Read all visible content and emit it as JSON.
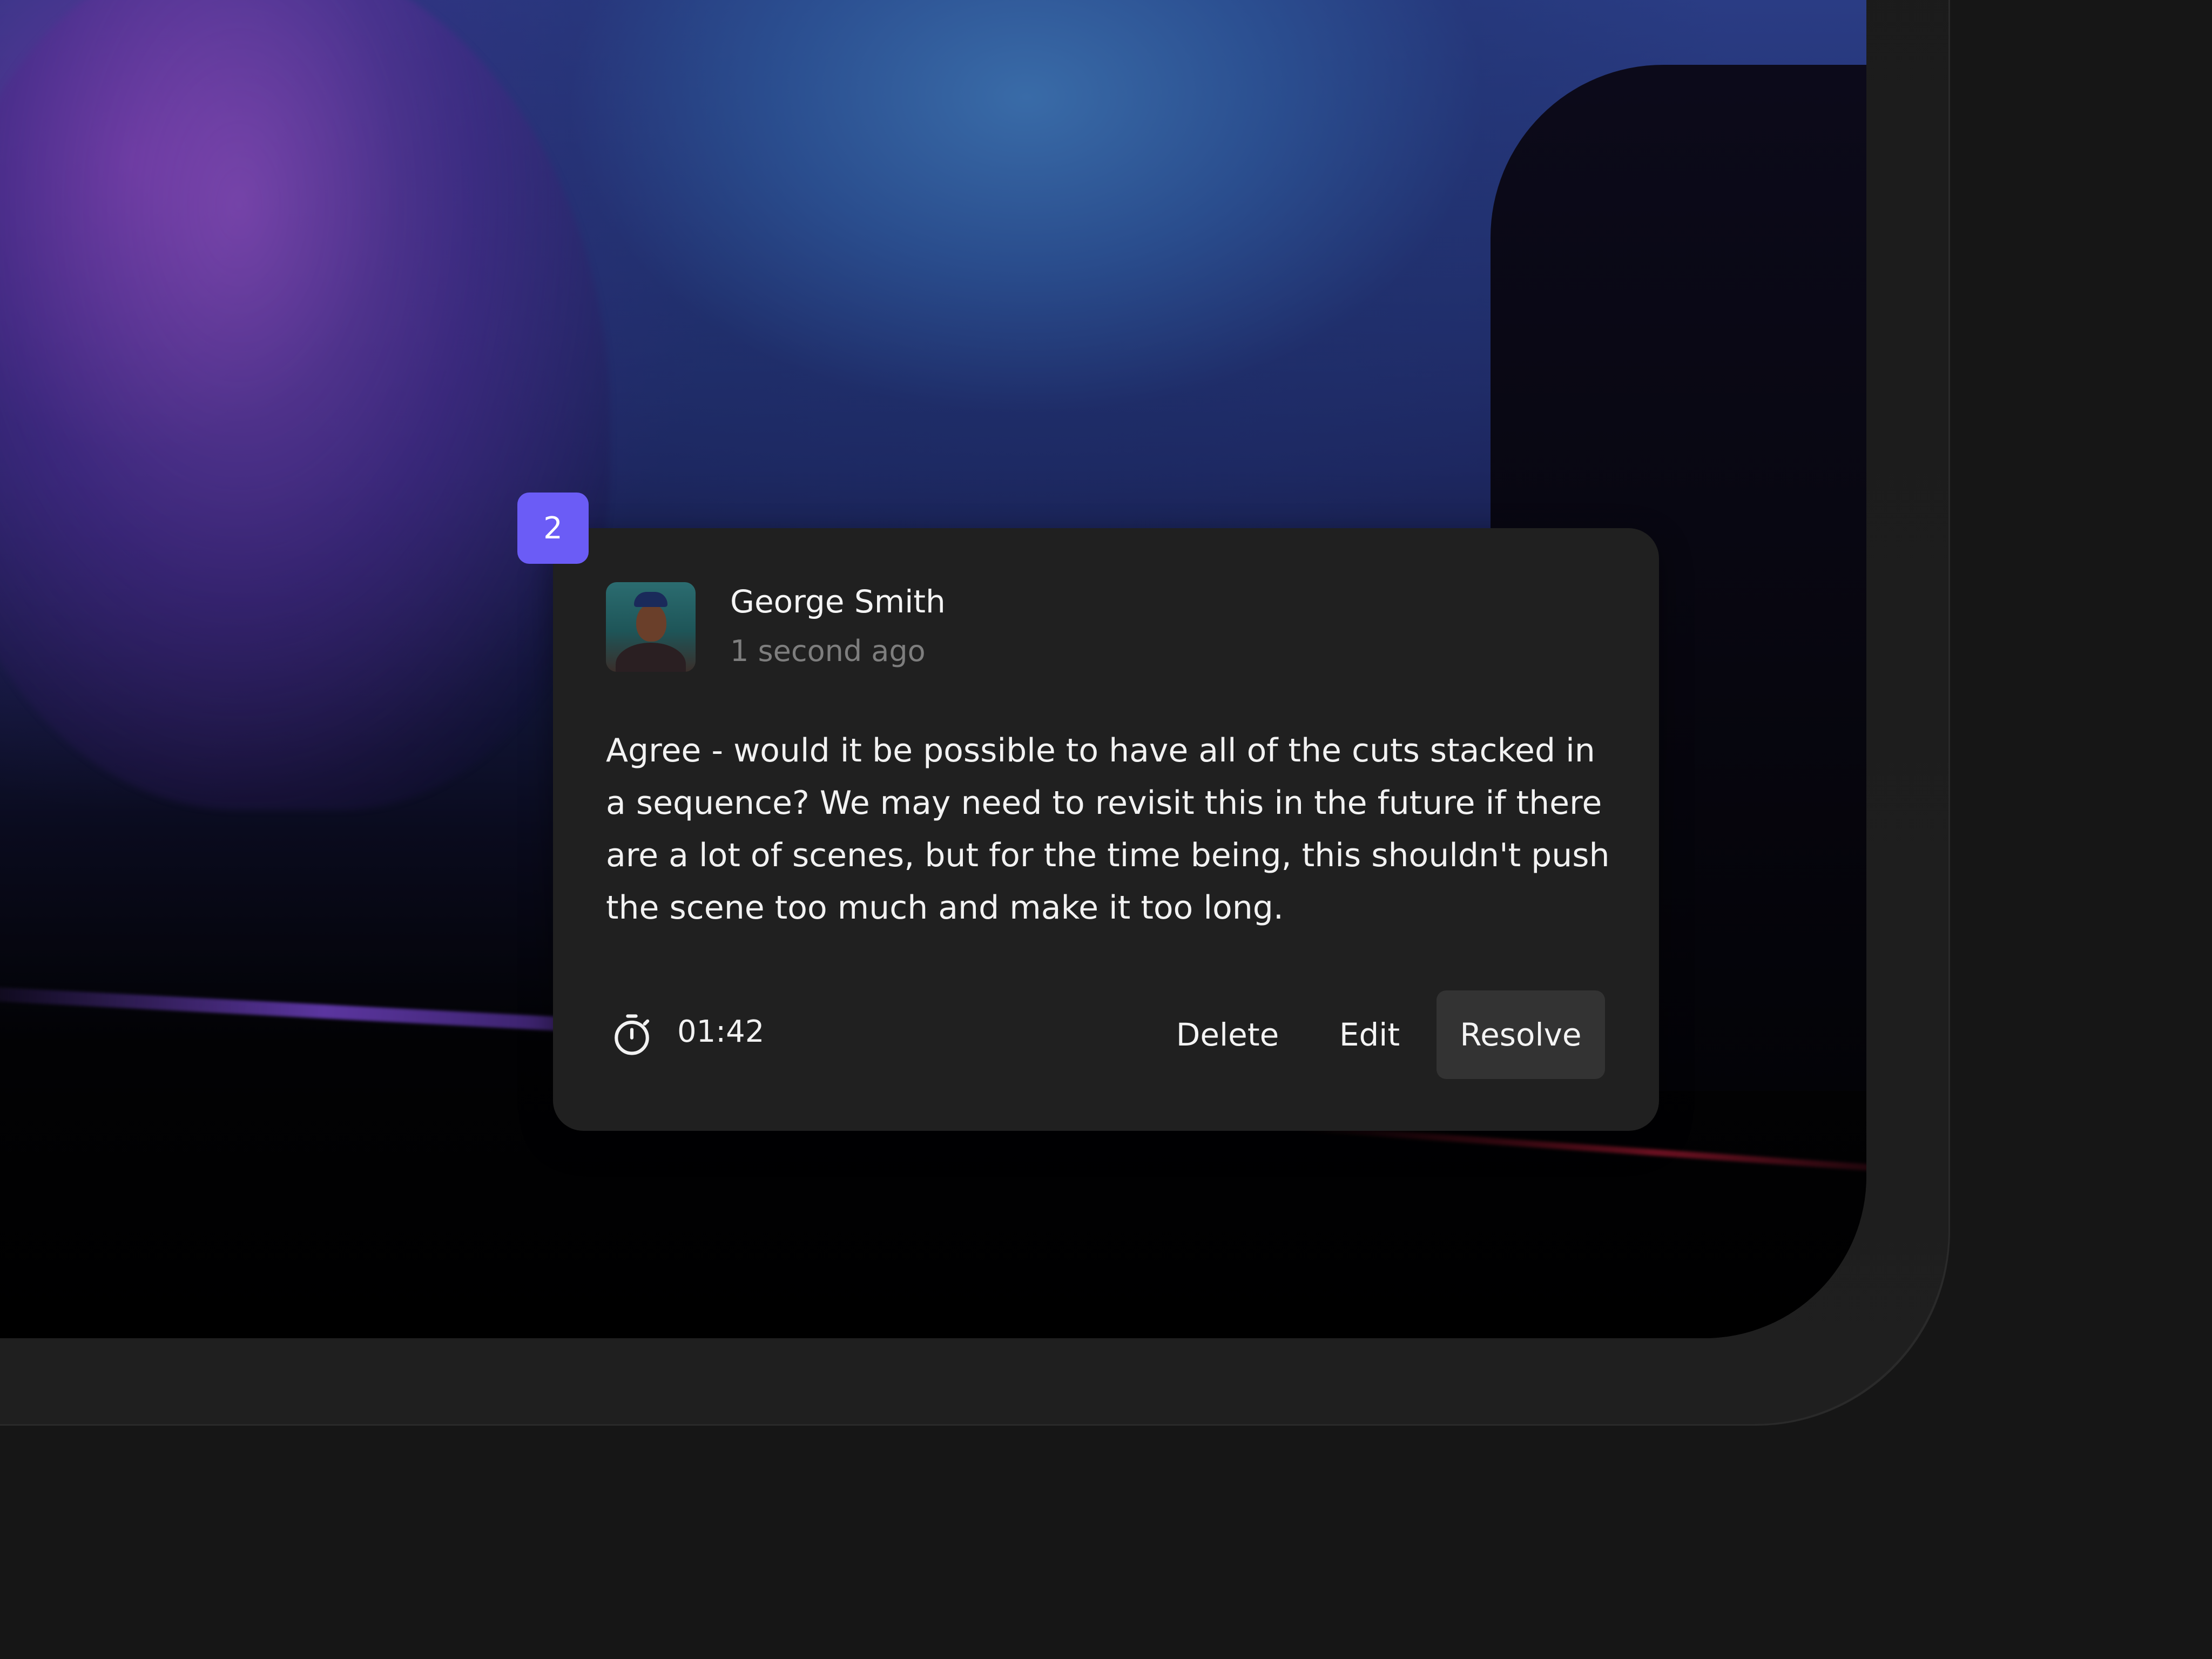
{
  "marker": {
    "number": "2",
    "color": "#6b5cf6"
  },
  "comment": {
    "author": "George Smith",
    "timestamp": "1 second ago",
    "body": "Agree - would it be possible to have all of the cuts stacked in a sequence? We may need to revisit this in the future if there are a lot of scenes, but for the time being, this shouldn't push the scene too much and make it too long.",
    "timecode": "01:42",
    "timecode_icon": "stopwatch-icon",
    "avatar": "user-avatar"
  },
  "actions": {
    "delete_label": "Delete",
    "edit_label": "Edit",
    "resolve_label": "Resolve"
  },
  "colors": {
    "background": "#161616",
    "card": "#202020",
    "resolve_button": "#333333",
    "text_primary": "#f4f4f4",
    "text_secondary": "#7e7e7e"
  }
}
